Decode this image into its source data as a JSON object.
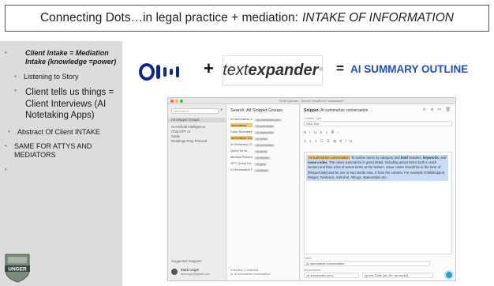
{
  "slide": {
    "title_main": "Connecting Dots…in legal practice + mediation:",
    "title_italic": "INTAKE OF INFORMATION"
  },
  "bullets": [
    {
      "text": "Client Intake = Mediation Intake (knowledge =power)"
    },
    {
      "text": "Listening to Story"
    },
    {
      "text": "Client tells us things = Client Interviews (AI Notetaking Apps)"
    },
    {
      "text": "Abstract Of Client INTAKE"
    },
    {
      "text": "SAME FOR ATTYS AND MEDIATORS"
    },
    {
      "text": ""
    }
  ],
  "bullet_glyph": "•",
  "logos": {
    "otter_icon": "otter-logo-icon",
    "plus": "+",
    "textexpander_prefix": "text",
    "textexpander_bold": "expander",
    "textexpander_reg": "®",
    "equals": "=",
    "ai_summary": "AI SUMMARY OUTLINE",
    "ai_color": "#1f4ecf",
    "unger_label": "UNGER"
  },
  "app": {
    "window_title": "TextExpander - Search results for “summarize”",
    "sidebar_search": "summarize",
    "sidebar_items": [
      {
        "label": "All Snippet Groups",
        "active": true
      },
      {
        "label": "AI Artificial Intelligence",
        "active": false
      },
      {
        "label": "Chat GPT AI",
        "active": false
      },
      {
        "label": "Sadie",
        "active": false
      },
      {
        "label": "Readings Prep Protocol",
        "active": false
      }
    ],
    "suggested": "Suggested Snippets",
    "user_name": "Mark Unger",
    "user_email": "mmunger@gmail.com",
    "list_header": "Search: All Snippet Groups",
    "list_rows": [
      {
        "label": "AI summarize conversa...",
        "tag": ";ai.summarize.conv"
      },
      {
        "label": "summarize",
        "tag": ";ai.summarize"
      },
      {
        "label": "Case Summary",
        "tag": ";ai.casesumm"
      },
      {
        "label": "summarize Conversation",
        "tag": ";ai.convo"
      },
      {
        "label": "AI Summary (Ca...",
        "tag": ";ai.summcase"
      },
      {
        "label": "Query for Ai...",
        "tag": ";ai.query"
      },
      {
        "label": "Medical Records S...",
        "tag": ";ai.medrec"
      },
      {
        "label": "GPT Query for...",
        "tag": ";ai.gptq"
      },
      {
        "label": "AI Information Retrieval...",
        "tag": ";ai.inforet"
      }
    ],
    "list_footer_1": "9 results / 1 selected",
    "list_footer_2": "in: ai.summarize.conversation",
    "detail_title_prefix": "Snippet:",
    "detail_title": "AI summarize conversation",
    "detail_icons": "⚙ ⊕ ↦ 🗑",
    "content_type_label": "Content Type",
    "content_type": "Rich Text",
    "toolbar_1": "B I U S  ≡ ≣  ⌂",
    "toolbar_2": "A  ≡ ≡  ☷  ☰  ⊞  B I U",
    "editor_line_1": "To outline items by category and",
    "editor_bold_1": "bold",
    "editor_line_1b": "headers,",
    "editor_bold_2": "keywords",
    "editor_line_1c": ", and",
    "editor_bold_3": "issue codes",
    "editor_line_2": ". The notes summarize in great detail, including action items both in each section and then a list of action items at the bottom. Issue codes should be in the form of [#issueCode] and be one or two words max.",
    "editor_line_3": "It from the content. For example #childSupport, #anger, #violence, #alcohol, #drugs, #parenttime etc.",
    "label_label": "Label",
    "label_value": "AI summarize conversation",
    "abbrev_label": "Abbreviation",
    "abbrev_value": ";ai.summarize.conv",
    "abbrev_note": "Ignore Case (ab, Ab, ab works)"
  }
}
